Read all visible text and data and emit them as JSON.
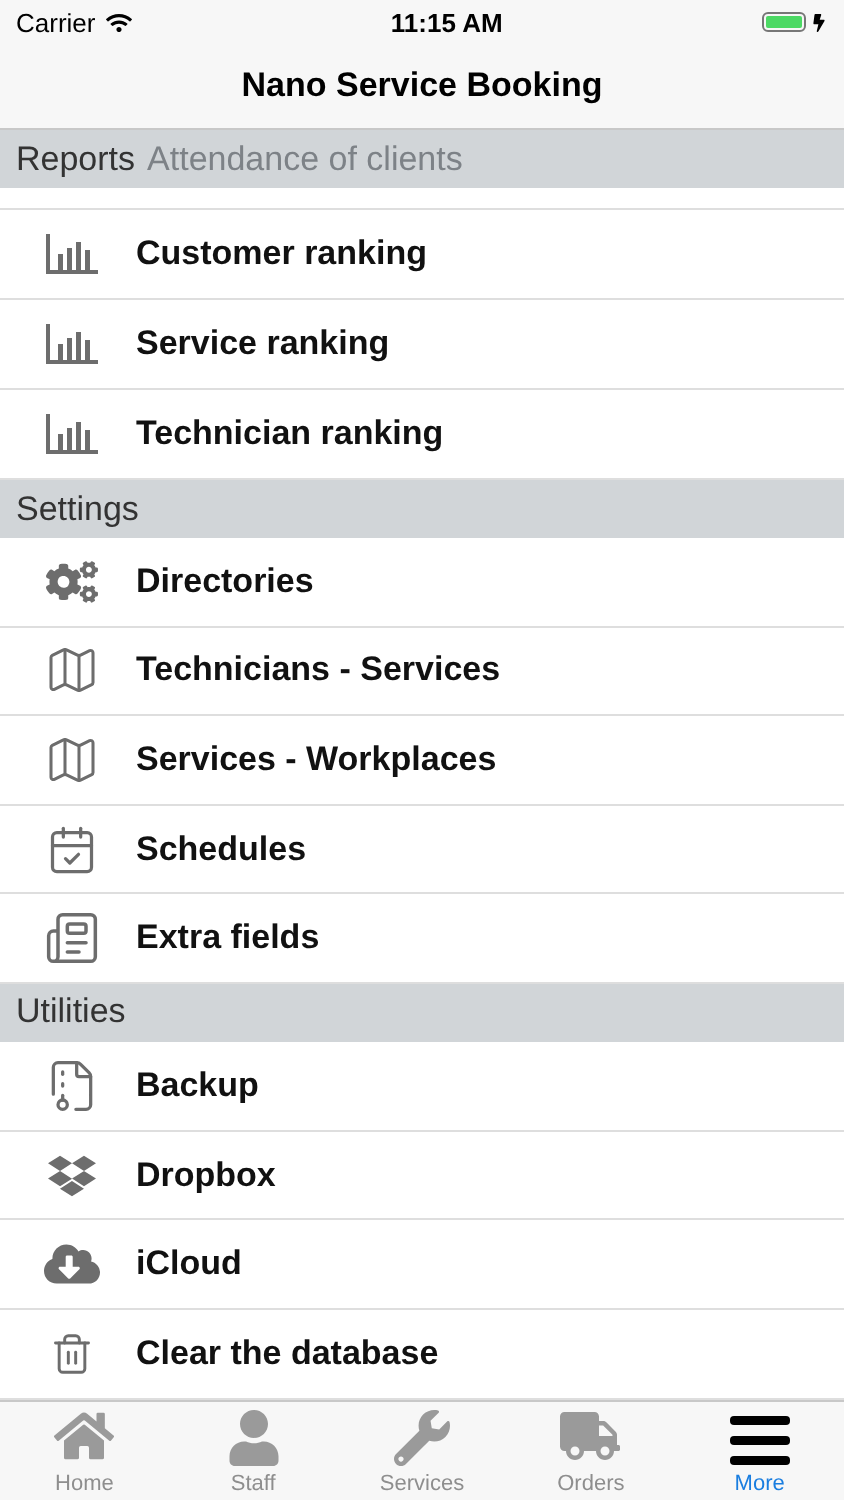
{
  "status_bar": {
    "carrier": "Carrier",
    "time": "11:15 AM",
    "charging": true
  },
  "nav": {
    "title": "Nano Service Booking"
  },
  "sections": [
    {
      "header": "Reports",
      "scrolled_under": "Attendance of clients",
      "items": [
        "Customer ranking",
        "Service ranking",
        "Technician ranking"
      ]
    },
    {
      "header": "Settings",
      "items": [
        "Directories",
        "Technicians - Services",
        "Services - Workplaces",
        "Schedules",
        "Extra fields"
      ]
    },
    {
      "header": "Utilities",
      "items": [
        "Backup",
        "Dropbox",
        "iCloud",
        "Clear the database"
      ]
    }
  ],
  "tabs": [
    {
      "label": "Home",
      "selected": false
    },
    {
      "label": "Staff",
      "selected": false
    },
    {
      "label": "Services",
      "selected": false
    },
    {
      "label": "Orders",
      "selected": false
    },
    {
      "label": "More",
      "selected": true
    }
  ]
}
